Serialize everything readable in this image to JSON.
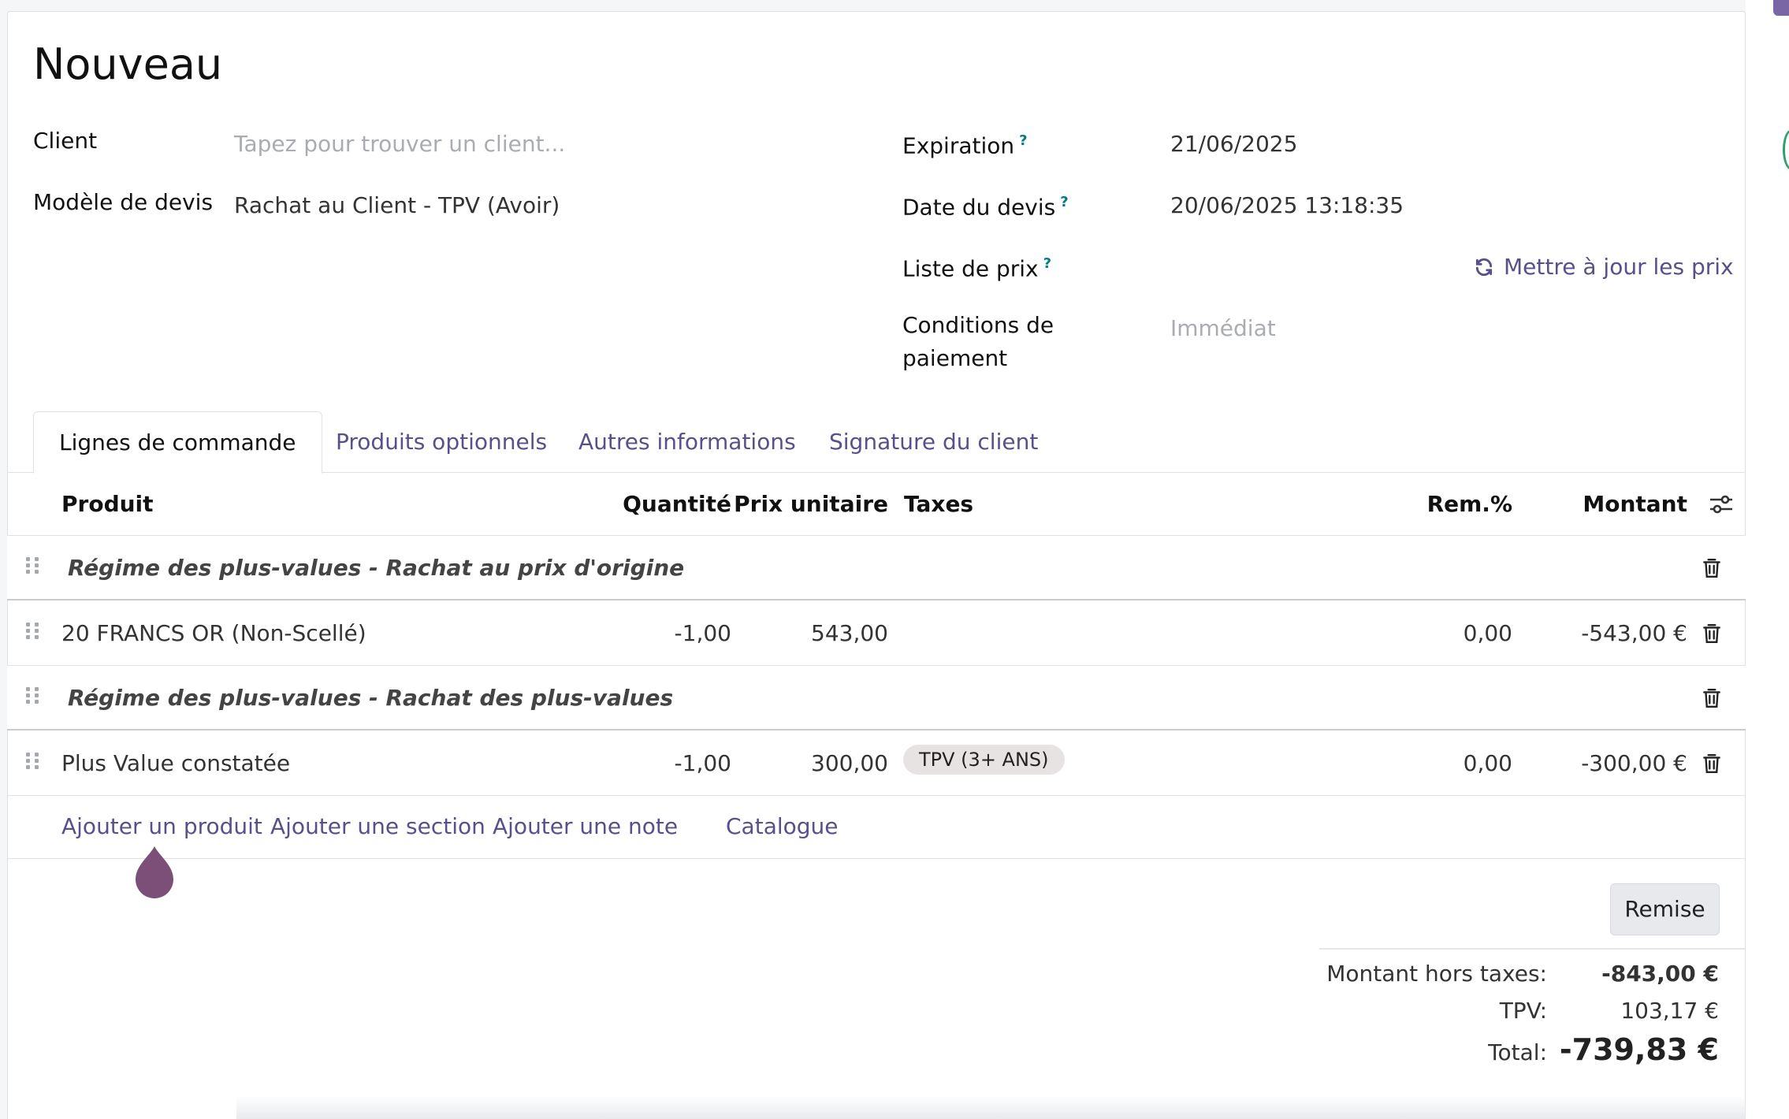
{
  "form": {
    "title": "Nouveau",
    "client_label": "Client",
    "client_placeholder": "Tapez pour trouver un client...",
    "template_label": "Modèle de devis",
    "template_value": "Rachat au Client - TPV (Avoir)",
    "expiration_label": "Expiration",
    "expiration_value": "21/06/2025",
    "date_label": "Date du devis",
    "date_value": "20/06/2025 13:18:35",
    "pricelist_label": "Liste de prix",
    "update_prices": "Mettre à jour les prix",
    "payment_terms_label_1": "Conditions de",
    "payment_terms_label_2": "paiement",
    "payment_terms_placeholder": "Immédiat",
    "help_mark": "?"
  },
  "tabs": [
    {
      "label": "Lignes de commande"
    },
    {
      "label": "Produits optionnels"
    },
    {
      "label": "Autres informations"
    },
    {
      "label": "Signature du client"
    }
  ],
  "table": {
    "headers": {
      "product": "Produit",
      "quantity": "Quantité",
      "unit_price": "Prix unitaire",
      "taxes": "Taxes",
      "discount": "Rem.%",
      "amount": "Montant"
    },
    "rows": [
      {
        "type": "section",
        "label": "Régime des plus-values - Rachat au prix d'origine"
      },
      {
        "type": "line",
        "product": "20 FRANCS OR (Non-Scellé)",
        "quantity": "-1,00",
        "unit_price": "543,00",
        "tax": "",
        "discount": "0,00",
        "amount": "-543,00 €"
      },
      {
        "type": "section",
        "label": "Régime des plus-values - Rachat des plus-values"
      },
      {
        "type": "line",
        "product": "Plus Value constatée",
        "quantity": "-1,00",
        "unit_price": "300,00",
        "tax": "TPV (3+ ANS)",
        "discount": "0,00",
        "amount": "-300,00 €"
      }
    ],
    "actions": {
      "add_product": "Ajouter un produit",
      "add_section": "Ajouter une section",
      "add_note": "Ajouter une note",
      "catalog": "Catalogue"
    }
  },
  "footer": {
    "discount_button": "Remise",
    "untaxed_label": "Montant hors taxes:",
    "untaxed_value": "-843,00 €",
    "tpv_label": "TPV:",
    "tpv_value": "103,17 €",
    "total_label": "Total:",
    "total_value": "-739,83 €"
  },
  "colors": {
    "link": "#5a4f8a",
    "help": "#017e84",
    "cursor": "#7b4f78"
  }
}
